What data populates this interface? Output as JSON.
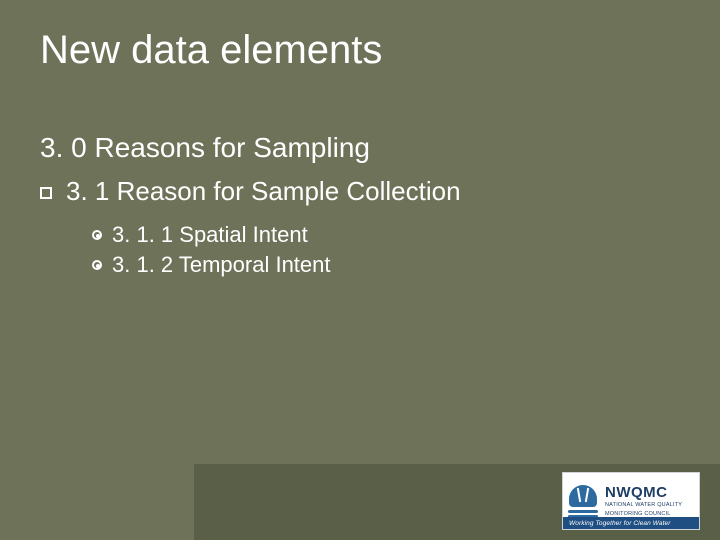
{
  "title": "New data elements",
  "section": {
    "heading": "3. 0 Reasons for Sampling",
    "sub": {
      "heading": "3. 1 Reason for Sample Collection",
      "items": [
        "3. 1. 1 Spatial Intent",
        "3. 1. 2 Temporal Intent"
      ]
    }
  },
  "logo": {
    "acronym": "NWQMC",
    "sub_line1": "NATIONAL WATER QUALITY",
    "sub_line2": "MONITORING COUNCIL",
    "tagline": "Working Together for Clean Water"
  }
}
